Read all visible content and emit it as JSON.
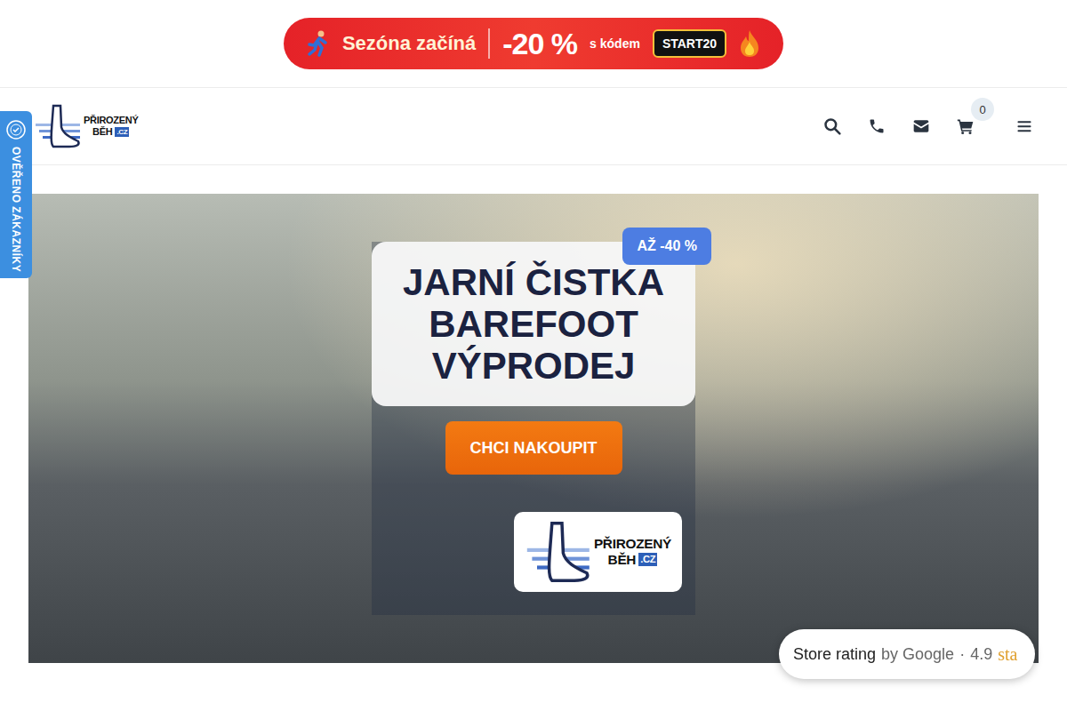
{
  "promo": {
    "title": "Sezóna začíná",
    "discount": "-20 %",
    "code_label": "s kódem",
    "code": "START20"
  },
  "logo": {
    "line1": "PŘIROZENÝ",
    "line2": "BĚH",
    "tld": ".CZ"
  },
  "header": {
    "cart_count": "0"
  },
  "verified_tab": {
    "label": "OVĚŘENO ZÁKAZNÍKY"
  },
  "hero": {
    "badge": "AŽ -40 %",
    "title_lines": [
      "JARNÍ ČISTKA",
      "BAREFOOT",
      "VÝPRODEJ"
    ],
    "button": "CHCI NAKOUPIT"
  },
  "rating": {
    "label": "Store rating",
    "by": "by Google",
    "separator": "·",
    "score": "4.9",
    "stars_text": "sta"
  }
}
